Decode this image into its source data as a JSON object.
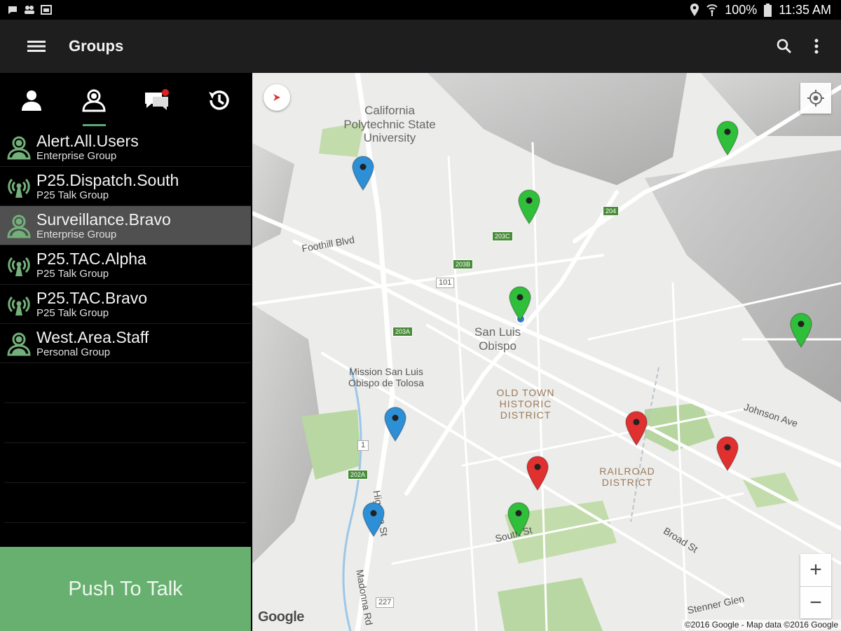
{
  "status_bar": {
    "battery": "100%",
    "time": "11:35 AM"
  },
  "app_bar": {
    "title": "Groups"
  },
  "groups": [
    {
      "name": "Alert.All.Users",
      "type": "Enterprise Group",
      "icon": "users-icon",
      "selected": false
    },
    {
      "name": "P25.Dispatch.South",
      "type": "P25 Talk Group",
      "icon": "radio-tower-icon",
      "selected": false
    },
    {
      "name": "Surveillance.Bravo",
      "type": "Enterprise Group",
      "icon": "users-icon",
      "selected": true
    },
    {
      "name": "P25.TAC.Alpha",
      "type": "P25 Talk Group",
      "icon": "radio-tower-icon",
      "selected": false
    },
    {
      "name": "P25.TAC.Bravo",
      "type": "P25 Talk Group",
      "icon": "radio-tower-icon",
      "selected": false
    },
    {
      "name": "West.Area.Staff",
      "type": "Personal Group",
      "icon": "users-icon",
      "selected": false
    }
  ],
  "ptt": {
    "label": "Push To Talk"
  },
  "map": {
    "labels": {
      "campus": "California Polytechnic State University",
      "city": "San Luis Obispo",
      "mission": "Mission San Luis Obispo de Tolosa",
      "old_town": "OLD TOWN HISTORIC DISTRICT",
      "railroad": "RAILROAD DISTRICT",
      "broad_st": "Broad St",
      "johnson_ave": "Johnson Ave",
      "foothill": "Foothill Blvd",
      "higuera": "Higuera St",
      "south_st": "South St",
      "madonna": "Madonna Rd",
      "stenner": "Stenner Glen",
      "route_101": "101",
      "route_1": "1",
      "route_227": "227"
    },
    "exits": [
      "204",
      "203C",
      "203B",
      "203A",
      "202A"
    ],
    "zoom_in": "+",
    "zoom_out": "−",
    "google": "Google",
    "copyright": "©2016 Google - Map data ©2016 Google",
    "colors": {
      "pin_green": "#2fbf3a",
      "pin_blue": "#2d8fd6",
      "pin_red": "#e03030",
      "ptt_green": "#67b06f",
      "tab_underline": "#5ea87a"
    }
  }
}
